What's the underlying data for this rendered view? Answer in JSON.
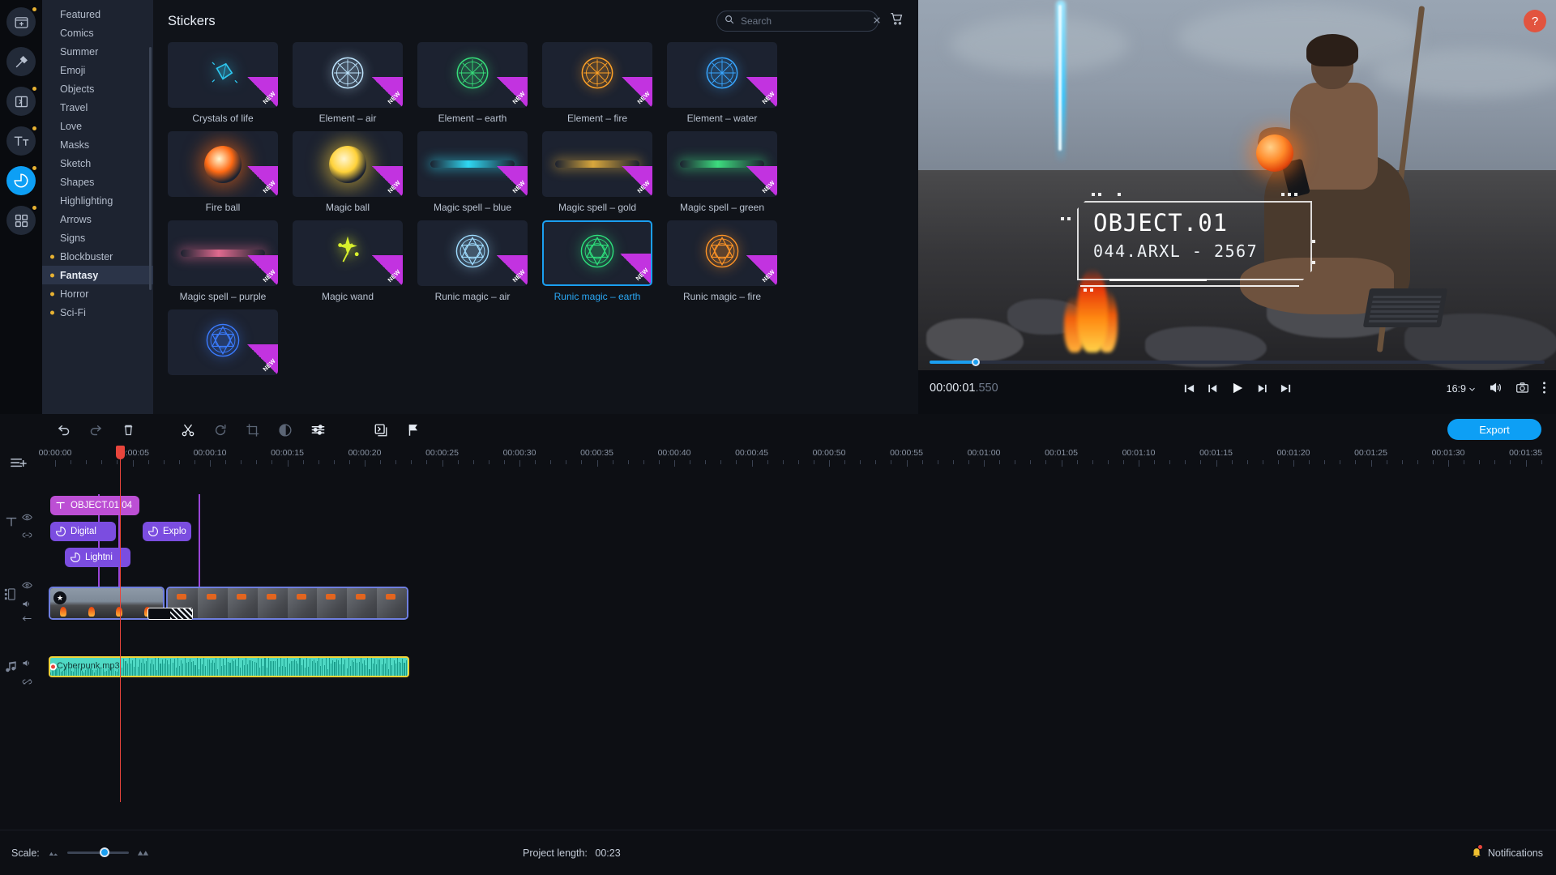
{
  "rail": {
    "items": [
      {
        "name": "media-import",
        "icon": "folder-plus-icon",
        "dot": true,
        "active": false
      },
      {
        "name": "effects",
        "icon": "magic-wand-icon",
        "dot": false,
        "active": false
      },
      {
        "name": "transitions",
        "icon": "transition-icon",
        "dot": true,
        "active": false
      },
      {
        "name": "titles",
        "icon": "text-icon",
        "dot": true,
        "active": false
      },
      {
        "name": "stickers",
        "icon": "sticker-icon",
        "dot": true,
        "active": true
      },
      {
        "name": "more-tools",
        "icon": "grid-icon",
        "dot": true,
        "active": false
      }
    ]
  },
  "categories": {
    "items": [
      {
        "label": "Featured",
        "bullet": false,
        "selected": false
      },
      {
        "label": "Comics",
        "bullet": false,
        "selected": false
      },
      {
        "label": "Summer",
        "bullet": false,
        "selected": false
      },
      {
        "label": "Emoji",
        "bullet": false,
        "selected": false
      },
      {
        "label": "Objects",
        "bullet": false,
        "selected": false
      },
      {
        "label": "Travel",
        "bullet": false,
        "selected": false
      },
      {
        "label": "Love",
        "bullet": false,
        "selected": false
      },
      {
        "label": "Masks",
        "bullet": false,
        "selected": false
      },
      {
        "label": "Sketch",
        "bullet": false,
        "selected": false
      },
      {
        "label": "Shapes",
        "bullet": false,
        "selected": false
      },
      {
        "label": "Highlighting",
        "bullet": false,
        "selected": false
      },
      {
        "label": "Arrows",
        "bullet": false,
        "selected": false
      },
      {
        "label": "Signs",
        "bullet": false,
        "selected": false
      },
      {
        "label": "Blockbuster",
        "bullet": true,
        "selected": false
      },
      {
        "label": "Fantasy",
        "bullet": true,
        "selected": true
      },
      {
        "label": "Horror",
        "bullet": true,
        "selected": false
      },
      {
        "label": "Sci-Fi",
        "bullet": true,
        "selected": false
      }
    ]
  },
  "panel": {
    "title": "Stickers",
    "search_placeholder": "Search",
    "search_value": "",
    "cart_icon": "cart-icon",
    "new_badge": "NEW",
    "stickers": [
      {
        "label": "Crystals of life",
        "new": true,
        "selected": false,
        "color": "#2ec7ef",
        "shape": "crystal"
      },
      {
        "label": "Element – air",
        "new": true,
        "selected": false,
        "color": "#bfe6ff",
        "shape": "ring"
      },
      {
        "label": "Element – earth",
        "new": true,
        "selected": false,
        "color": "#37dd7a",
        "shape": "ring"
      },
      {
        "label": "Element – fire",
        "new": true,
        "selected": false,
        "color": "#ffa227",
        "shape": "ring"
      },
      {
        "label": "Element – water",
        "new": true,
        "selected": false,
        "color": "#38a6ff",
        "shape": "ring"
      },
      {
        "label": "Fire ball",
        "new": true,
        "selected": false,
        "color": "#ff6a14",
        "shape": "ball"
      },
      {
        "label": "Magic ball",
        "new": true,
        "selected": false,
        "color": "#ffd23a",
        "shape": "ball"
      },
      {
        "label": "Magic spell – blue",
        "new": true,
        "selected": false,
        "color": "#2fd8f2",
        "shape": "streak"
      },
      {
        "label": "Magic spell – gold",
        "new": true,
        "selected": false,
        "color": "#d8a73c",
        "shape": "streak"
      },
      {
        "label": "Magic spell – green",
        "new": true,
        "selected": false,
        "color": "#3ddc7e",
        "shape": "streak"
      },
      {
        "label": "Magic spell – purple",
        "new": true,
        "selected": false,
        "color": "#e06a8f",
        "shape": "streak"
      },
      {
        "label": "Magic wand",
        "new": true,
        "selected": false,
        "color": "#d8f02c",
        "shape": "spark"
      },
      {
        "label": "Runic magic – air",
        "new": true,
        "selected": false,
        "color": "#9fdcff",
        "shape": "rune"
      },
      {
        "label": "Runic magic – earth",
        "new": true,
        "selected": true,
        "color": "#2ee07c",
        "shape": "rune"
      },
      {
        "label": "Runic magic – fire",
        "new": true,
        "selected": false,
        "color": "#ff9426",
        "shape": "rune"
      },
      {
        "label": "",
        "new": true,
        "selected": false,
        "color": "#3b7cff",
        "shape": "rune"
      }
    ]
  },
  "preview": {
    "help_label": "?",
    "hud_line1": "OBJECT.01",
    "hud_line2": "044.ARXL - 2567",
    "time_main": "00:00:01",
    "time_ms": ".550",
    "aspect_ratio": "16:9",
    "transport": [
      {
        "name": "go-to-start-button",
        "icon": "skip-start-icon"
      },
      {
        "name": "prev-frame-button",
        "icon": "step-back-icon"
      },
      {
        "name": "play-button",
        "icon": "play-icon"
      },
      {
        "name": "next-frame-button",
        "icon": "step-forward-icon"
      },
      {
        "name": "go-to-end-button",
        "icon": "skip-end-icon"
      }
    ],
    "right_controls": [
      {
        "name": "volume-button",
        "icon": "speaker-icon"
      },
      {
        "name": "snapshot-button",
        "icon": "camera-icon"
      },
      {
        "name": "more-options-button",
        "icon": "kebab-icon"
      }
    ]
  },
  "toolbar": {
    "items": [
      {
        "name": "undo-button",
        "icon": "undo-icon",
        "dim": false
      },
      {
        "name": "redo-button",
        "icon": "redo-icon",
        "dim": true
      },
      {
        "name": "delete-button",
        "icon": "trash-icon",
        "dim": false
      },
      {
        "name": "split-button",
        "icon": "scissors-icon",
        "dim": false
      },
      {
        "name": "rotate-button",
        "icon": "rotate-icon",
        "dim": true
      },
      {
        "name": "crop-button",
        "icon": "crop-icon",
        "dim": true
      },
      {
        "name": "color-adjust-button",
        "icon": "contrast-icon",
        "dim": true
      },
      {
        "name": "properties-button",
        "icon": "sliders-icon",
        "dim": false
      },
      {
        "name": "clip-properties-button",
        "icon": "clip-props-icon",
        "dim": false
      },
      {
        "name": "marker-button",
        "icon": "flag-icon",
        "dim": false
      }
    ],
    "export_label": "Export"
  },
  "timeline": {
    "ruler_labels": [
      "00:00:00",
      "00:00:05",
      "00:00:10",
      "00:00:15",
      "00:00:20",
      "00:00:25",
      "00:00:30",
      "00:00:35",
      "00:00:40",
      "00:00:45",
      "00:00:50",
      "00:00:55",
      "00:01:00",
      "00:01:05",
      "00:01:10",
      "00:01:15",
      "00:01:20",
      "00:01:25",
      "00:01:30",
      "00:01:35"
    ],
    "title_clip": {
      "label": "OBJECT.01 04",
      "icon": "text-icon"
    },
    "sticker_clips": [
      {
        "label": "Digital",
        "icon": "sticker-icon"
      },
      {
        "label": "Explo",
        "icon": "sticker-icon"
      },
      {
        "label": "Lightni",
        "icon": "sticker-icon"
      }
    ],
    "audio_clip": {
      "label": "Cyberpunk.mp3"
    },
    "track_heads": [
      {
        "name": "text-track",
        "icons": [
          "text-icon",
          "eye-icon",
          "link-icon"
        ]
      },
      {
        "name": "video-track",
        "icons": [
          "film-icon",
          "eye-icon",
          "speaker-icon",
          "arrow-icon"
        ]
      },
      {
        "name": "audio-track",
        "icons": [
          "music-note-icon",
          "speaker-icon",
          "detach-icon"
        ]
      }
    ],
    "add_track_icon": "add-track-icon"
  },
  "status": {
    "scale_label": "Scale:",
    "project_length_label": "Project length:",
    "project_length_value": "00:23",
    "notifications_label": "Notifications"
  }
}
